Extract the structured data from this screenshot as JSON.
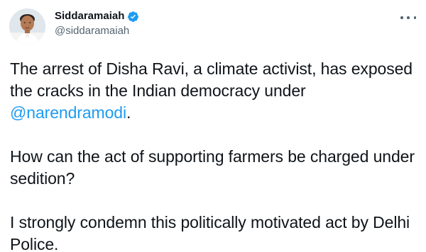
{
  "author": {
    "display_name": "Siddaramaiah",
    "handle": "@siddaramaiah",
    "verified": true,
    "avatar": "profile-photo"
  },
  "menu": {
    "icon": "more-horizontal-icon"
  },
  "tweet": {
    "paragraph_1_before": "The arrest of Disha Ravi, a climate activist, has exposed the cracks in the Indian democracy under ",
    "paragraph_1_mention": "@narendramodi",
    "paragraph_1_after": ".",
    "paragraph_2": "How can the act of supporting farmers be charged under sedition?",
    "paragraph_3": "I strongly condemn this politically motivated act by Delhi Police."
  },
  "colors": {
    "link": "#1d9bf0",
    "text": "#0f1419",
    "secondary": "#536471",
    "verified": "#1d9bf0"
  }
}
